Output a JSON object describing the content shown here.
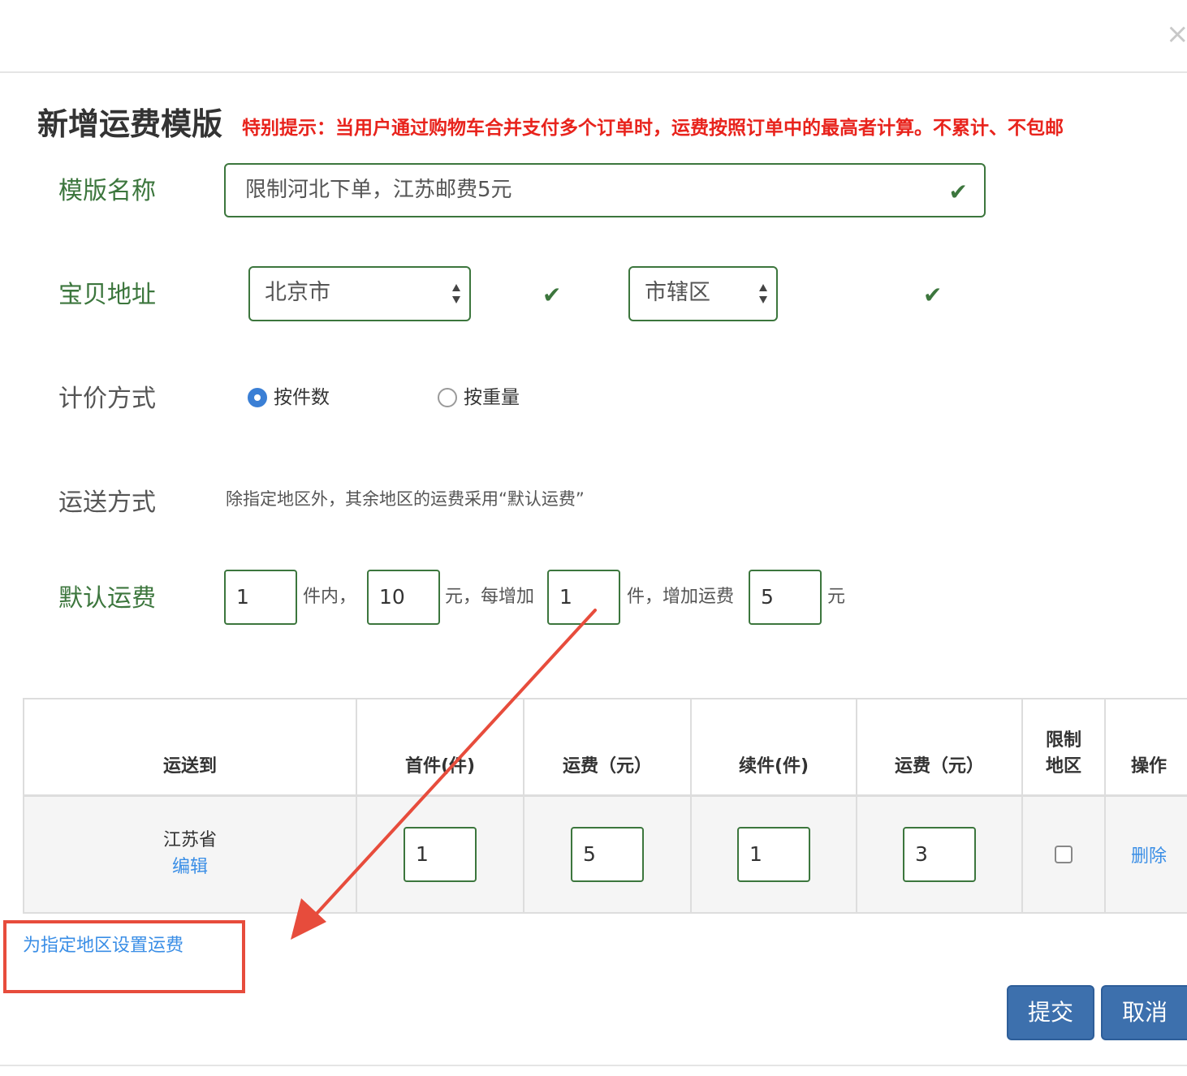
{
  "modal": {
    "close_icon": "×",
    "title": "新增运费模版",
    "notice": "特别提示：当用户通过购物车合并支付多个订单时，运费按照订单中的最高者计算。不累计、不包邮"
  },
  "form": {
    "template_name": {
      "label": "模版名称",
      "value": "限制河北下单，江苏邮费5元",
      "check_icon": "✔"
    },
    "address": {
      "label": "宝贝地址",
      "province": "北京市",
      "district": "市辖区",
      "check_icon": "✔"
    },
    "pricing": {
      "label": "计价方式",
      "options": [
        {
          "label": "按件数",
          "selected": true
        },
        {
          "label": "按重量",
          "selected": false
        }
      ]
    },
    "shipping": {
      "label": "运送方式",
      "description": "除指定地区外，其余地区的运费采用“默认运费”"
    },
    "default_fee": {
      "label": "默认运费",
      "first_qty": "1",
      "text_within": "件内，",
      "first_fee": "10",
      "text_each_add": "元，每增加",
      "add_qty": "1",
      "text_add_fee": "件，增加运费",
      "add_fee": "5",
      "text_yuan": "元"
    }
  },
  "table": {
    "headers": [
      "运送到",
      "首件(件)",
      "运费（元）",
      "续件(件)",
      "运费（元）",
      "限制地区",
      "操作"
    ],
    "rows": [
      {
        "region": "江苏省",
        "edit_label": "编辑",
        "first_qty": "1",
        "first_fee": "5",
        "add_qty": "1",
        "add_fee": "3",
        "restrict_checked": false,
        "action_label": "删除"
      }
    ]
  },
  "region_link": "为指定地区设置运费",
  "annotation_color": "#e74c3c",
  "buttons": {
    "submit": "提交",
    "cancel": "取消"
  }
}
